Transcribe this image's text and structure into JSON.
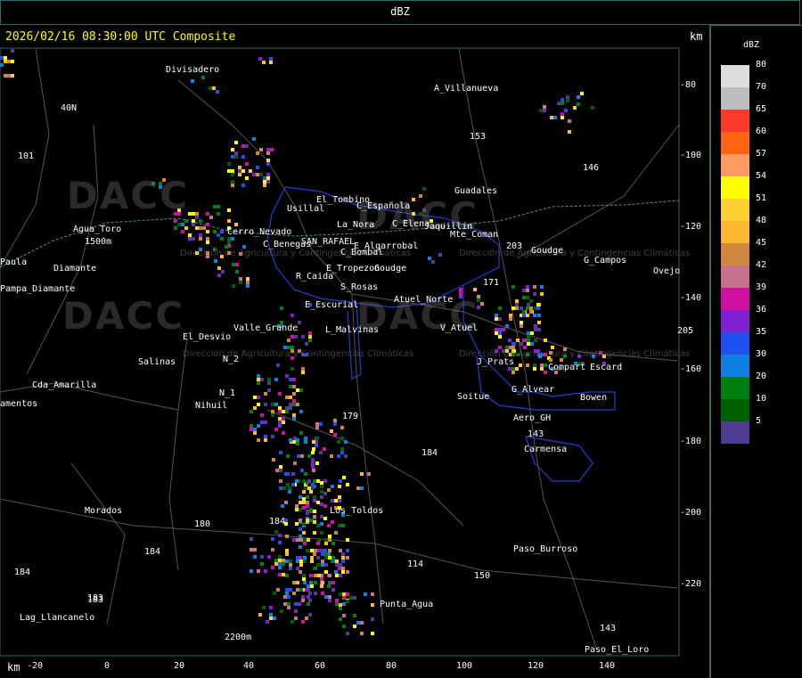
{
  "header": {
    "title": "dBZ"
  },
  "map": {
    "timestamp": "2026/02/16 08:30:00 UTC Composite",
    "km_label_top": "km",
    "km_label_bottom": "km",
    "y_ticks": [
      "-80",
      "-100",
      "-120",
      "-140",
      "-160",
      "-180",
      "-200",
      "-220"
    ],
    "x_ticks": [
      "-20",
      "0",
      "20",
      "40",
      "60",
      "80",
      "100",
      "120",
      "140"
    ],
    "watermarks": [
      {
        "text": "DACC",
        "sub": "Dirección de Agricultura\ny Contingencias Climáticas"
      },
      {
        "text": "DACC",
        "sub": "Dirección de Agricultura\ny Contingencias Climáticas"
      },
      {
        "text": "DACC",
        "sub": "Dirección de Agricultura\ny Contingencias Climáticas"
      },
      {
        "text": "DACC",
        "sub": "Dirección de Agricultura\ny Contingencias Climáticas"
      }
    ],
    "places": [
      "Divisadero",
      "A_Villanueva",
      "40N",
      "101",
      "153",
      "146",
      "Guadales",
      "El_Tombino",
      "Usillal",
      "C_Española",
      "La_Nora",
      "C_Elena",
      "Jaquillín",
      "Agua_Toro",
      "1500m",
      "SAN_RAFAEL",
      "C_Benegas",
      "E_Algarrobal",
      "Mte_Coman",
      "203",
      "Goudge",
      "G_Campos",
      "Ovejo",
      "Paula",
      "Pampa_Diamante",
      "Diamante",
      "Cerro_Nevado",
      "C_Bombal",
      "E_Tropezon",
      "Goudge",
      "R_Caida",
      "S_Rosas",
      "Atuel_Norte",
      "171",
      "E_Escurial",
      "Valle_Grande",
      "L_Malvinas",
      "V_Atuel",
      "205",
      "El_Desvio",
      "Salinas",
      "N_2",
      "N_1",
      "Nihuil",
      "J_Prats",
      "Compart",
      "Escard",
      "Soitue",
      "G_Alvear",
      "Bowen",
      "Cda_Amarilla",
      "amentos",
      "179",
      "Aero_GH",
      "143",
      "184",
      "Carmensa",
      "Morados",
      "180",
      "184",
      "Los_Toldos",
      "184",
      "Paso_Burroso",
      "150",
      "184",
      "183",
      "Punta_Agua",
      "Lag_Llancanelo",
      "2200m",
      "143",
      "Paso_El_Loro",
      "114",
      "183"
    ]
  },
  "legend": {
    "title": "dBZ",
    "entries": [
      {
        "label": "80",
        "color": "#dcdcdc"
      },
      {
        "label": "70",
        "color": "#bebebe"
      },
      {
        "label": "65",
        "color": "#ff3a2a"
      },
      {
        "label": "60",
        "color": "#ff6410"
      },
      {
        "label": "57",
        "color": "#ff9a64"
      },
      {
        "label": "54",
        "color": "#ffff00"
      },
      {
        "label": "51",
        "color": "#ffd030"
      },
      {
        "label": "48",
        "color": "#ffb830"
      },
      {
        "label": "45",
        "color": "#d08840"
      },
      {
        "label": "42",
        "color": "#c87090"
      },
      {
        "label": "39",
        "color": "#d010a0"
      },
      {
        "label": "36",
        "color": "#8020d0"
      },
      {
        "label": "35",
        "color": "#2050f0"
      },
      {
        "label": "30",
        "color": "#1080e0"
      },
      {
        "label": "20",
        "color": "#008010"
      },
      {
        "label": "10",
        "color": "#006000"
      },
      {
        "label": "5",
        "color": "#503c90"
      }
    ]
  }
}
